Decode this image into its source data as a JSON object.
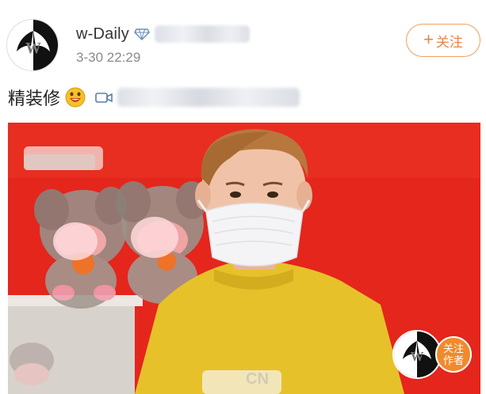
{
  "post": {
    "author": {
      "name": "w-Daily",
      "avatar_icon": "w-daily-logo",
      "badge_icon": "diamond-icon"
    },
    "timestamp": "3-30 22:29",
    "follow_label": "关注",
    "follow_icon": "+",
    "text": "精装修",
    "emoji_icon": "grinning-face-emoji",
    "link_icon": "video-icon"
  },
  "media": {
    "type": "video-screenshot",
    "background_color": "#e8251c",
    "shirt_color": "#e8c12a",
    "mask_color": "#f4f4f6",
    "bottom_text": "CN"
  },
  "watermark": {
    "logo_icon": "w-daily-logo",
    "follow_label": "关注作者",
    "follow_color": "#f08a2c"
  },
  "colors": {
    "accent": "#e8834a",
    "muted": "#8a8a8a"
  }
}
